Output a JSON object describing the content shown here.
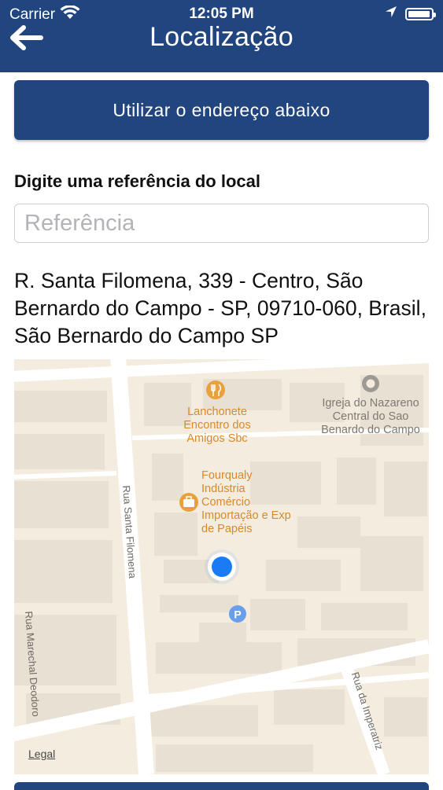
{
  "status_bar": {
    "carrier": "Carrier",
    "time": "12:05 PM"
  },
  "header": {
    "title": "Localização",
    "back_icon": "arrow-left-icon"
  },
  "actions": {
    "use_address_label": "Utilizar o endereço abaixo"
  },
  "reference": {
    "label": "Digite uma referência do local",
    "placeholder": "Referência",
    "value": ""
  },
  "address": {
    "text": "R. Santa Filomena, 339 - Centro, São Bernardo do Campo - SP, 09710-060, Brasil, São Bernardo do Campo SP"
  },
  "map": {
    "poi_lanchonete": "Lanchonete Encontro dos Amigos Sbc",
    "poi_fourqualy": "Fourqualy Indústria Comércio Importação e Exp de Papéis",
    "poi_igreja": "Igreja do Nazareno Central do Sao Benardo do Campo",
    "street_santa_filomena": "Rua Santa Filomena",
    "street_marechal": "Rua Marechal Deodoro",
    "street_imperatriz": "Rua da Imperatriz",
    "legal": "Legal",
    "colors": {
      "land": "#f3ecdf",
      "building": "#e8e0d2",
      "road": "#ffffff",
      "user_dot": "#1a7cf5",
      "poi_orange": "#e8a13c",
      "parking": "#6a9ee8"
    }
  }
}
